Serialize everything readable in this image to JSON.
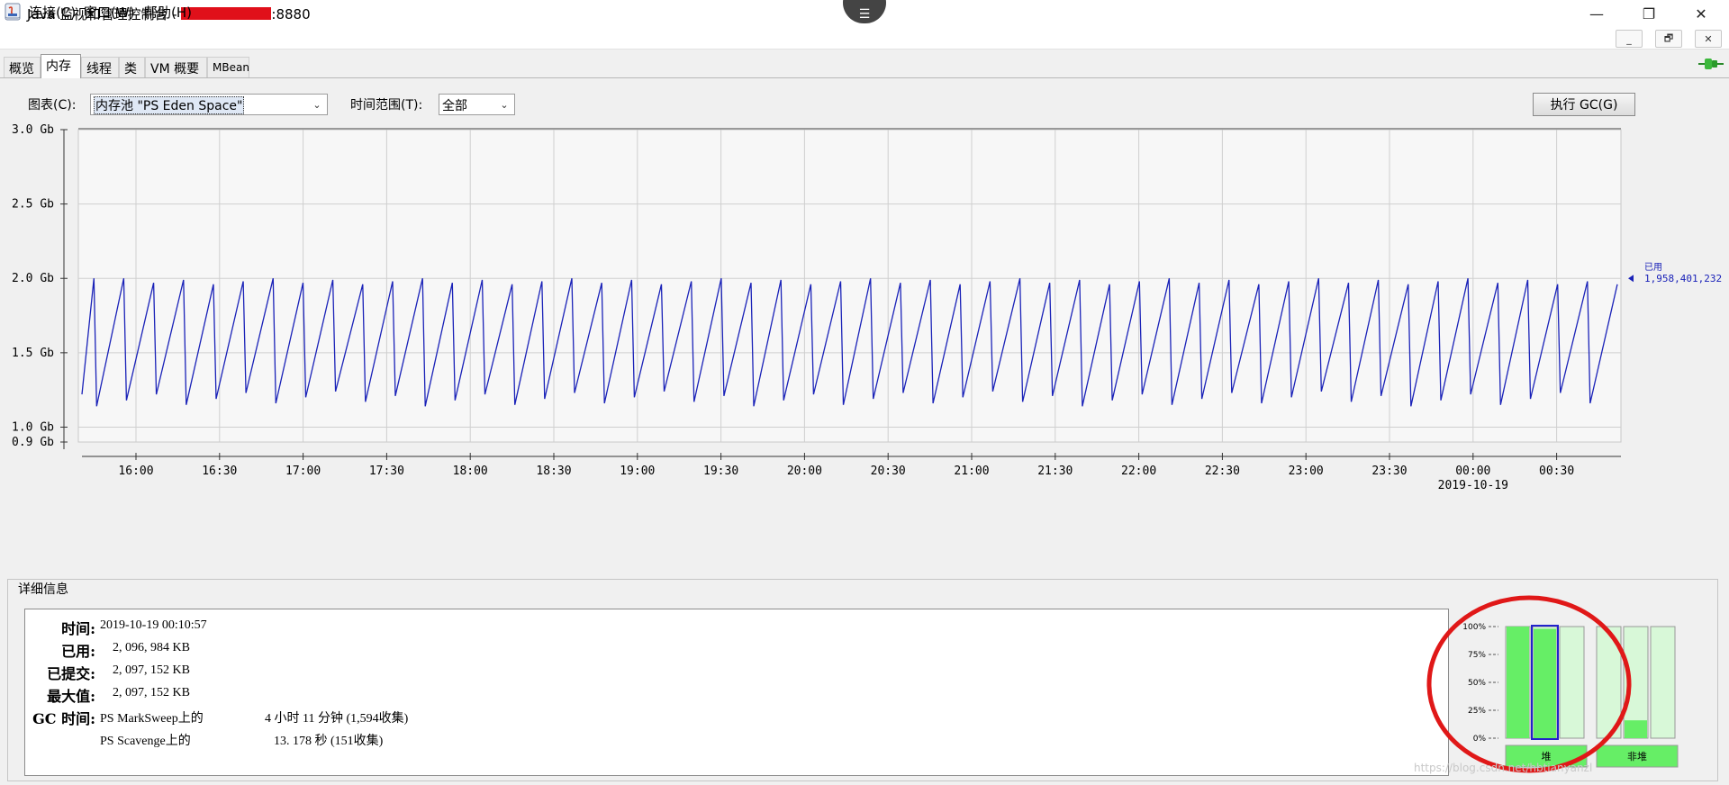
{
  "window": {
    "title_prefix": "Java 监视和管理控制台 - ",
    "title_redacted": "-----------",
    "title_port": ":8880",
    "controls": [
      "—",
      "❐",
      "✕"
    ]
  },
  "menu": {
    "items": [
      "连接(C)",
      "窗口(W)",
      "帮助(H)"
    ],
    "inner_controls": [
      "_",
      "🗗",
      "✕"
    ]
  },
  "tabs": [
    "概览",
    "内存",
    "线程",
    "类",
    "VM 概要",
    "MBean"
  ],
  "active_tab": "内存",
  "controls": {
    "chart_label": "图表(C):",
    "chart_value": "内存池 \"PS Eden Space\"",
    "range_label": "时间范围(T):",
    "range_value": "全部",
    "gc_button": "执行 GC(G)"
  },
  "chart_data": {
    "type": "line",
    "y_ticks": [
      "3.0 Gb",
      "2.5 Gb",
      "2.0 Gb",
      "1.5 Gb",
      "1.0 Gb",
      "0.9 Gb"
    ],
    "y_tick_values": [
      3.0,
      2.5,
      2.0,
      1.5,
      1.0,
      0.9
    ],
    "ylim": [
      0.9,
      3.0
    ],
    "x_ticks": [
      "16:00",
      "16:30",
      "17:00",
      "17:30",
      "18:00",
      "18:30",
      "19:00",
      "19:30",
      "20:00",
      "20:30",
      "21:00",
      "21:30",
      "22:00",
      "22:30",
      "23:00",
      "23:30",
      "00:00",
      "00:30"
    ],
    "x_date_label": "2019-10-19",
    "series": [
      {
        "name": "已用",
        "color": "#1a22b8",
        "current_value": "1,958,401,232",
        "sawtooth_min": 1.0,
        "sawtooth_max": 2.0,
        "cycles": 51
      }
    ],
    "grid": true,
    "legend": "right"
  },
  "details": {
    "title": "详细信息",
    "rows": [
      {
        "label": "时间:",
        "value": "2019-10-19 00:10:57"
      },
      {
        "label": "已用:",
        "value": "2, 096, 984 KB"
      },
      {
        "label": "已提交:",
        "value": "2, 097, 152 KB"
      },
      {
        "label": "最大值:",
        "value": "2, 097, 152 KB"
      }
    ],
    "gc_label": "GC 时间:",
    "gc_rows": [
      {
        "collector": "PS MarkSweep上的",
        "time": "4 小时 11 分钟 (1,594收集)"
      },
      {
        "collector": "PS Scavenge上的",
        "time": "13. 178 秒 (151收集)"
      }
    ]
  },
  "usage_bars": {
    "y_labels": [
      "100%",
      "75%",
      "50%",
      "25%",
      "0%"
    ],
    "heap_label": "堆",
    "nonheap_label": "非堆",
    "heap_fill": [
      1.0,
      0.98,
      0.0
    ],
    "nonheap_fill": [
      0.0,
      0.16,
      0.0
    ],
    "colors": {
      "fill": "#66ee66",
      "border": "#2222cc"
    }
  },
  "watermark": "https://blog.csdn.net/hbtianyanzl"
}
